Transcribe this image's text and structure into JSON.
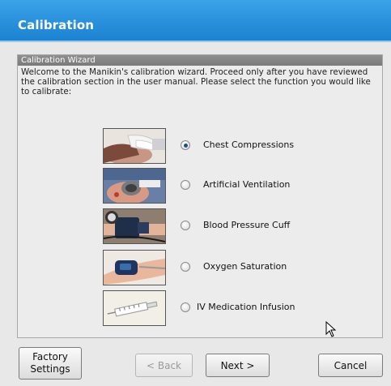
{
  "window": {
    "title": "Calibration"
  },
  "wizard": {
    "header": "Calibration Wizard",
    "intro": "Welcome to the Manikin's calibration wizard.  Proceed only after you have reviewed the calibration section in the user manual.  Please select the function you would like to calibrate:"
  },
  "options": [
    {
      "label": "Chest Compressions",
      "selected": true,
      "image": "chest-compression-photo"
    },
    {
      "label": "Artificial Ventilation",
      "selected": false,
      "image": "ventilation-mask-photo"
    },
    {
      "label": "Blood Pressure Cuff",
      "selected": false,
      "image": "bp-cuff-photo"
    },
    {
      "label": "Oxygen Saturation",
      "selected": false,
      "image": "pulse-oximeter-photo"
    },
    {
      "label": "IV Medication Infusion",
      "selected": false,
      "image": "syringe-photo"
    }
  ],
  "buttons": {
    "factory_line1": "Factory",
    "factory_line2": "Settings",
    "back": "< Back",
    "next": "Next >",
    "cancel": "Cancel"
  },
  "colors": {
    "titlebar": "#1a82d0",
    "wizard_header": "#848484"
  }
}
